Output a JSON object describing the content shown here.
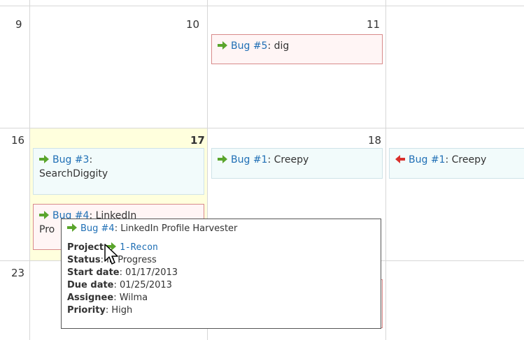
{
  "days": [
    {
      "num": "9"
    },
    {
      "num": "10"
    },
    {
      "num": "11"
    },
    {
      "num": "16"
    },
    {
      "num": "17"
    },
    {
      "num": "18"
    },
    {
      "num": "23"
    }
  ],
  "issues": [
    {
      "link": "Bug #5",
      "title": ": dig"
    },
    {
      "link": "Bug #3",
      "title": ":",
      "title2": "SearchDiggity"
    },
    {
      "link": "Bug #1",
      "title": ": Creepy"
    },
    {
      "link": "Bug #1",
      "title": ": Creepy"
    },
    {
      "link": "Bug #4",
      "title": ": LinkedIn",
      "title2": "Pro"
    }
  ],
  "tooltip": {
    "link": "Bug #4",
    "title": ": LinkedIn Profile Harvester",
    "project_label": "Project",
    "project_value": "1-Recon",
    "status_label": "Status",
    "status_value": ": In Progress",
    "start_label": "Start date",
    "start_value": ": 01/17/2013",
    "due_label": "Due date",
    "due_value": ": 01/25/2013",
    "assignee_label": "Assignee",
    "assignee_value": ": Wilma",
    "priority_label": "Priority",
    "priority_value": ": High"
  },
  "colors": {
    "arrow_green": "#5aa52c",
    "arrow_red": "#d9302c",
    "link": "#1f6fb5",
    "today_bg": "#ffffdd"
  }
}
